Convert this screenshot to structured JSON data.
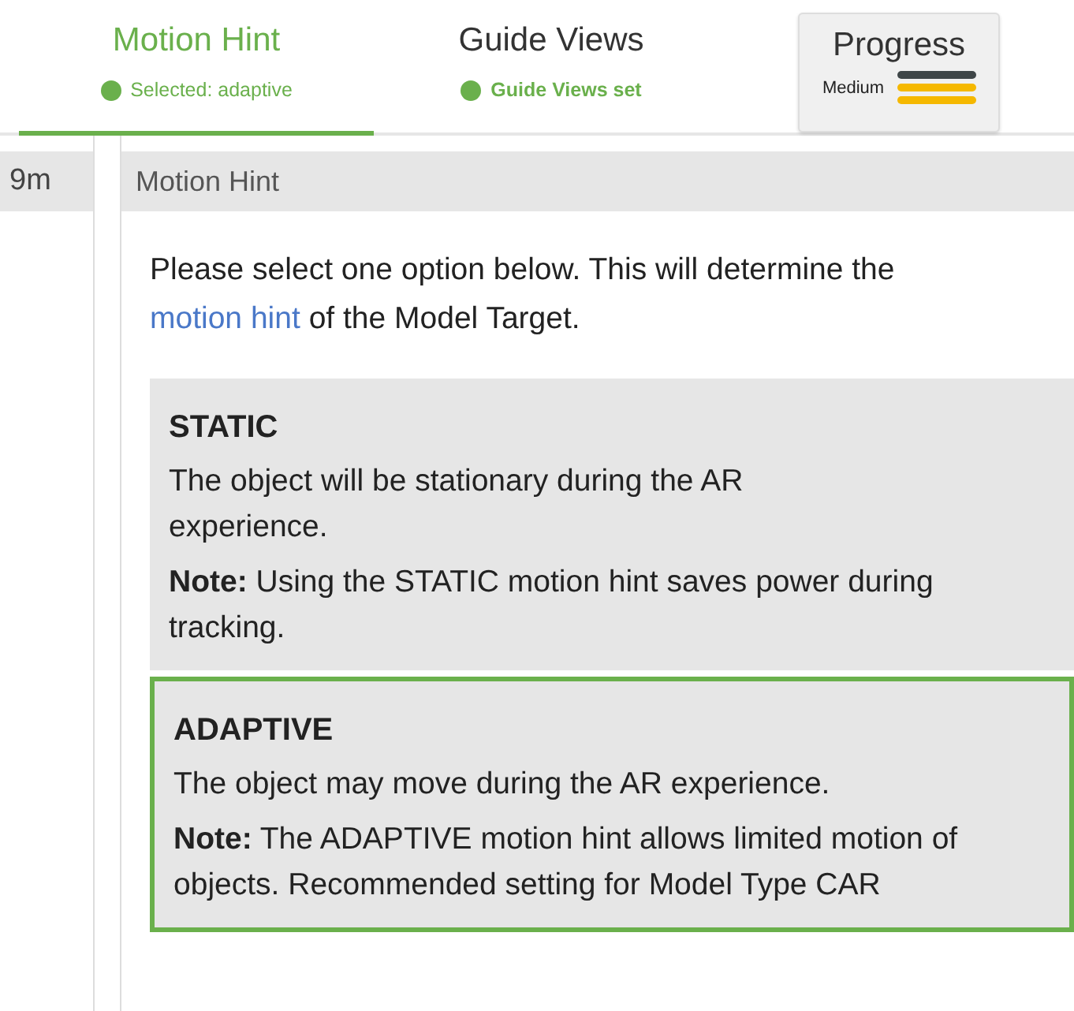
{
  "tabs": [
    {
      "label": "Motion Hint",
      "status": "Selected: adaptive",
      "selected": true
    },
    {
      "label": "Guide Views",
      "status": "Guide Views set",
      "selected": false
    }
  ],
  "progress": {
    "title": "Progress",
    "reading": "Medium",
    "level": 0.67
  },
  "side_column": {
    "text": "9m"
  },
  "panel": {
    "title": "Motion Hint",
    "intro_before": "Please select one option below. This will determine the",
    "intro_link": "motion hint",
    "intro_after": "of the Model Target.",
    "options": [
      {
        "name": "STATIC",
        "description": "The object will be stationary during the AR experience.",
        "note": "**Note:** Using the STATIC motion hint saves power during tracking.",
        "selected": false
      },
      {
        "name": "ADAPTIVE",
        "description": "The object may move during the AR experience.",
        "note": "**Note:** The ADAPTIVE motion hint allows limited motion of objects. Recommended setting for Model Type CAR",
        "selected": true
      }
    ]
  }
}
